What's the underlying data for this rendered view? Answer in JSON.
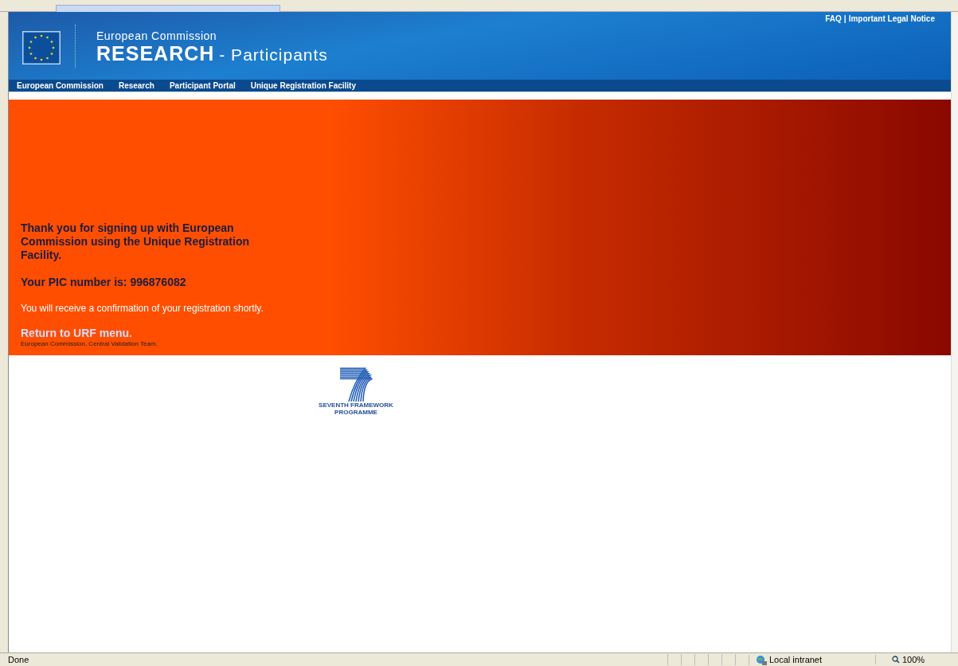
{
  "header": {
    "top_links": [
      "FAQ",
      "Important Legal Notice"
    ],
    "link_separator": "|",
    "org": "European Commission",
    "title": "RESEARCH",
    "subtitle": "- Participants"
  },
  "nav": [
    "European Commission",
    "Research",
    "Participant Portal",
    "Unique Registration Facility"
  ],
  "message": {
    "thanks": "Thank you for signing up with European Commission using the Unique Registration Facility.",
    "pic": "Your PIC number is: 996876082",
    "confirmation": "You will receive a confirmation of your registration shortly.",
    "link": "Return to URF menu.",
    "signature": "European Commission, Central Validation Team."
  },
  "logo": {
    "line_1": "SEVENTH FRAMEWORK",
    "line_2": "PROGRAMME"
  },
  "status_bar": {
    "status": "Done",
    "zone": "Local intranet",
    "zoom": "100%"
  }
}
